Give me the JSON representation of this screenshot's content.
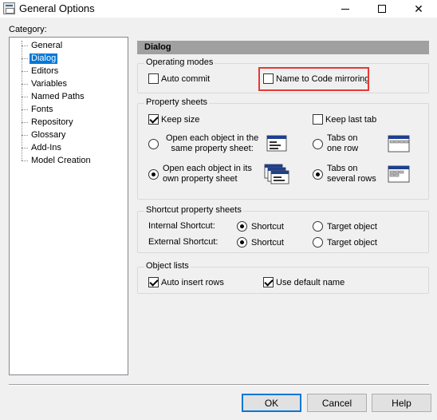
{
  "window": {
    "title": "General Options",
    "controls": {
      "minimize": "minimize",
      "maximize": "maximize",
      "close": "✕"
    }
  },
  "category": {
    "label": "Category:",
    "items": [
      "General",
      "Dialog",
      "Editors",
      "Variables",
      "Named Paths",
      "Fonts",
      "Repository",
      "Glossary",
      "Add-Ins",
      "Model Creation"
    ],
    "selected": "Dialog"
  },
  "panel": {
    "header": "Dialog",
    "operating_modes": {
      "title": "Operating modes",
      "auto_commit": {
        "label": "Auto commit",
        "checked": false
      },
      "name_to_code": {
        "label": "Name to Code mirroring",
        "checked": false
      }
    },
    "property_sheets": {
      "title": "Property sheets",
      "keep_size": {
        "label": "Keep size",
        "checked": true
      },
      "keep_last_tab": {
        "label": "Keep last tab",
        "checked": false
      },
      "open_same": {
        "line1": "Open each object in the",
        "line2": "same property sheet:",
        "selected": false
      },
      "open_own": {
        "line1": "Open each object in its",
        "line2": "own property sheet",
        "selected": true
      },
      "tabs_one_row": {
        "line1": "Tabs on",
        "line2": "one row",
        "selected": false
      },
      "tabs_several_rows": {
        "line1": "Tabs on",
        "line2": "several rows",
        "selected": true
      }
    },
    "shortcut_property_sheets": {
      "title": "Shortcut property sheets",
      "internal": {
        "label": "Internal Shortcut:",
        "shortcut": "Shortcut",
        "target": "Target object",
        "selected": "Shortcut"
      },
      "external": {
        "label": "External Shortcut:",
        "shortcut": "Shortcut",
        "target": "Target object",
        "selected": "Shortcut"
      }
    },
    "object_lists": {
      "title": "Object lists",
      "auto_insert_rows": {
        "label": "Auto insert rows",
        "checked": true
      },
      "use_default_name": {
        "label": "Use default name",
        "checked": true
      }
    }
  },
  "buttons": {
    "ok": "OK",
    "cancel": "Cancel",
    "help": "Help"
  },
  "colors": {
    "selection": "#0078d7",
    "highlight_box": "#e53935",
    "panel_header": "#a0a0a0"
  }
}
